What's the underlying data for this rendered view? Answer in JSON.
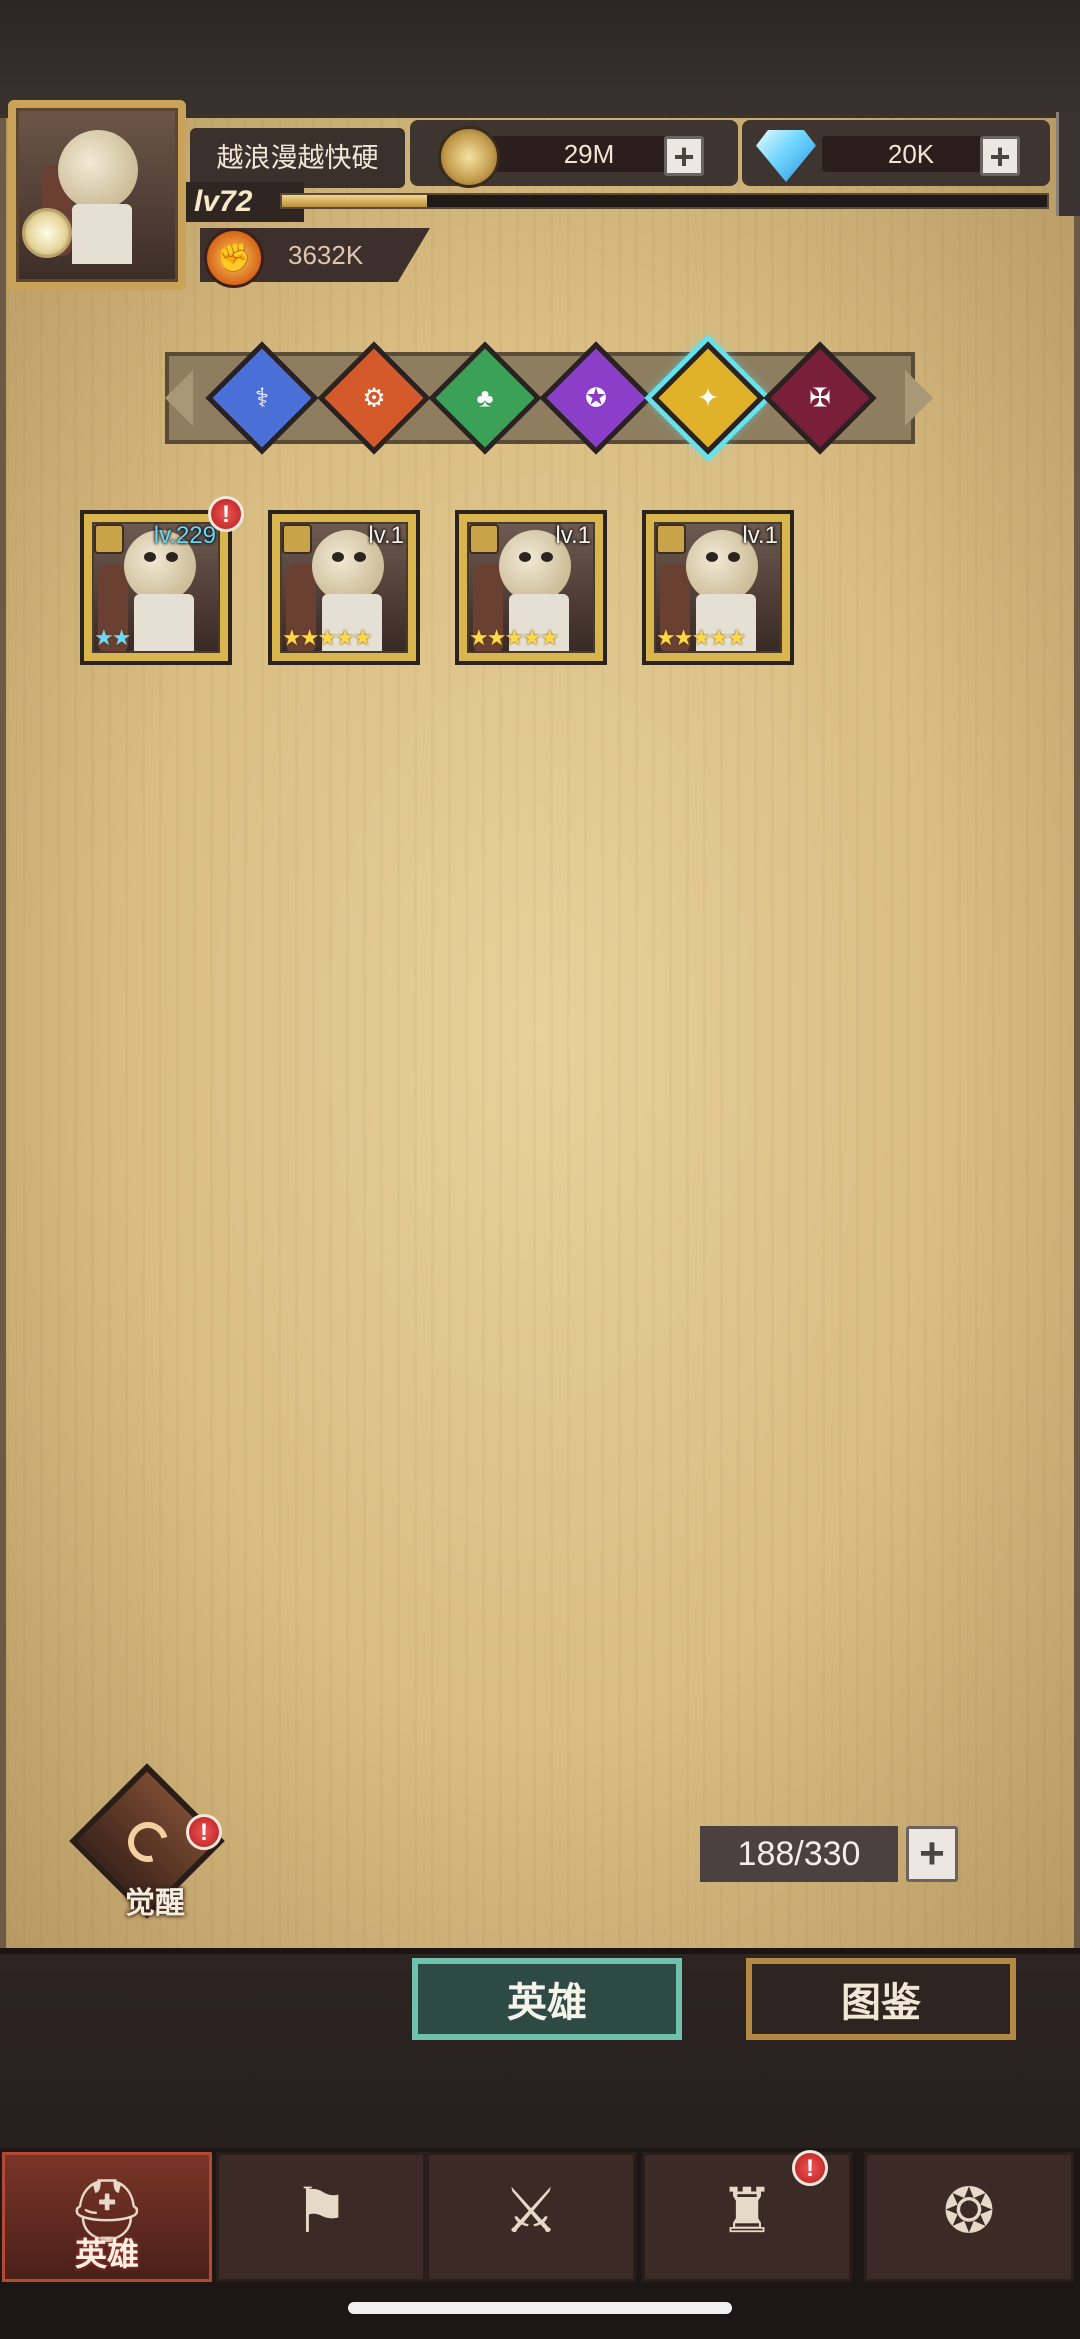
{
  "player": {
    "name": "越浪漫越快硬",
    "level": "lv72",
    "xp_fraction": 0.19,
    "power_value": "3632K"
  },
  "currencies": {
    "gold": {
      "icon": "gold-coin-icon",
      "value": "29M",
      "add_label": "+"
    },
    "gems": {
      "icon": "diamond-icon",
      "value": "20K",
      "add_label": "+"
    }
  },
  "factions": [
    {
      "name": "faction-blue",
      "glyph": "⚕",
      "color": "#4a6fd6",
      "active": false
    },
    {
      "name": "faction-orange",
      "glyph": "⚙",
      "color": "#d45a2c",
      "active": false
    },
    {
      "name": "faction-green",
      "glyph": "♣",
      "color": "#3aa156",
      "active": false
    },
    {
      "name": "faction-purple",
      "glyph": "✪",
      "color": "#8b3fc9",
      "active": false
    },
    {
      "name": "faction-gold",
      "glyph": "✦",
      "color": "#e0b22a",
      "active": true
    },
    {
      "name": "faction-dark",
      "glyph": "✠",
      "color": "#7a1f3a",
      "active": false
    }
  ],
  "heroes": [
    {
      "level": "lv.229",
      "stars": "★★",
      "star_color": "blue",
      "alert": "!"
    },
    {
      "level": "lv.1",
      "stars": "★★★★★",
      "star_color": "gold",
      "alert": ""
    },
    {
      "level": "lv.1",
      "stars": "★★★★★",
      "star_color": "gold",
      "alert": ""
    },
    {
      "level": "lv.1",
      "stars": "★★★★★",
      "star_color": "gold",
      "alert": ""
    }
  ],
  "awaken": {
    "label": "觉醒",
    "alert": "!"
  },
  "capacity": {
    "value": "188/330",
    "add_label": "+"
  },
  "tabs": {
    "hero": "英雄",
    "atlas": "图鉴"
  },
  "nav": [
    {
      "icon": "helmet-icon",
      "glyph": "⛑",
      "label": "英雄",
      "active": true,
      "alert": ""
    },
    {
      "icon": "flag-icon",
      "glyph": "⚑",
      "label": "",
      "active": false,
      "alert": ""
    },
    {
      "icon": "crossed-swords-icon",
      "glyph": "⚔",
      "label": "",
      "active": false,
      "alert": ""
    },
    {
      "icon": "castle-icon",
      "glyph": "♜",
      "label": "",
      "active": false,
      "alert": "!"
    },
    {
      "icon": "alliance-icon",
      "glyph": "❂",
      "label": "",
      "active": false,
      "alert": ""
    }
  ],
  "alert_glyph": "!"
}
